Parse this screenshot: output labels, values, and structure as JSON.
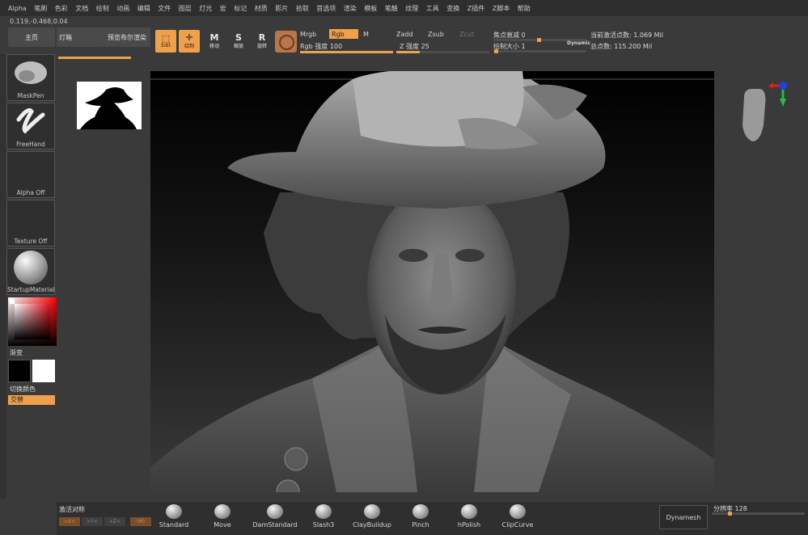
{
  "menu": [
    "Alpha",
    "笔刷",
    "色彩",
    "文档",
    "绘制",
    "动画",
    "编辑",
    "文件",
    "图层",
    "灯光",
    "宏",
    "标记",
    "材质",
    "影片",
    "拾取",
    "首选项",
    "渲染",
    "模板",
    "笔触",
    "纹理",
    "工具",
    "变换",
    "Z插件",
    "Z脚本",
    "帮助"
  ],
  "coords": "0.119,-0.468,0.04",
  "toolbar": {
    "home": "主页",
    "lightbox": "灯箱",
    "preview_bool": "预览布尔渲染",
    "edit": "Edit",
    "draw": "绘制",
    "move": "移动",
    "scale": "缩放",
    "rotate": "旋转",
    "mrgb": "Mrgb",
    "rgb": "Rgb",
    "m": "M",
    "rgb_intensity_label": "Rgb 强度",
    "rgb_intensity_value": "100",
    "rgb_intensity_level": 1.0,
    "zadd": "Zadd",
    "zsub": "Zsub",
    "zcut": "Zcut",
    "z_intensity_label": "Z 强度",
    "z_intensity_value": "25",
    "z_intensity_level": 0.25,
    "focal_label": "焦点衰减",
    "focal_value": "0",
    "draw_size_label": "绘制大小",
    "draw_size_value": "1",
    "dynamic": "Dynamic",
    "active_points": "当前激活点数: 1.069 Mil",
    "total_points": "总点数: 115.200 Mil"
  },
  "shelf": {
    "brush": "MaskPen",
    "stroke": "FreeHand",
    "alpha": "Alpha Off",
    "texture": "Texture Off",
    "material": "StartupMaterial",
    "gradient": "渐变",
    "switch_color": "切换颜色",
    "alternate": "交替"
  },
  "bottom": {
    "symmetry": "激活对称",
    "sym_x": ">X<",
    "sym_y": ">Y<",
    "sym_z": ">Z<",
    "sym_m": "(M)",
    "brushes": [
      "Standard",
      "Move",
      "DamStandard",
      "Slash3",
      "ClayBuildup",
      "Pinch",
      "hPolish",
      "ClipCurve"
    ],
    "dynamesh": "Dynamesh",
    "resolution_label": "分辨率",
    "resolution_value": "128"
  },
  "colors": {
    "accent": "#f0a04b",
    "bg": "#3a3a3a",
    "axis_red": "#e02020",
    "axis_green": "#20c040",
    "axis_blue": "#2040e0"
  }
}
